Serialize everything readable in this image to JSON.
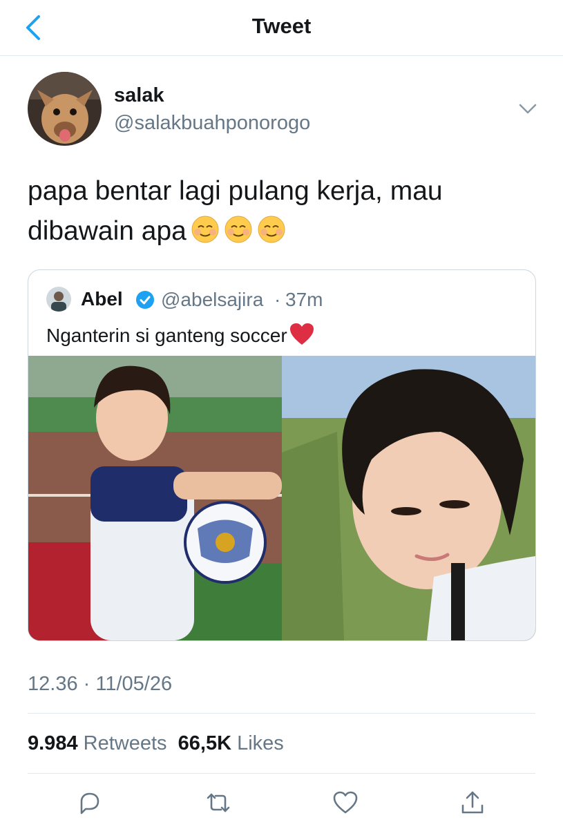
{
  "header": {
    "title": "Tweet"
  },
  "tweet": {
    "display_name": "salak",
    "handle": "@salakbuahponorogo",
    "text": "papa bentar lagi pulang kerja, mau dibawain apa",
    "emojis": [
      "smiling-face-icon",
      "smiling-face-icon",
      "smiling-face-icon"
    ],
    "timestamp": "12.36 · 11/05/26",
    "stats": {
      "retweets_count": "9.984",
      "retweets_label": "Retweets",
      "likes_count": "66,5K",
      "likes_label": "Likes"
    }
  },
  "quoted_tweet": {
    "display_name": "Abel",
    "handle": "@abelsajira",
    "separator": "·",
    "time": "37m",
    "text": "Nganterin si ganteng soccer",
    "text_emoji": "red-heart-icon",
    "media": [
      "boy-with-soccer-ball-photo",
      "selfie-on-field-photo"
    ]
  },
  "actions": [
    "reply-icon",
    "retweet-icon",
    "like-icon",
    "share-icon"
  ],
  "colors": {
    "accent": "#1da1f2",
    "text": "#14171a",
    "secondary": "#657786",
    "border": "#e1e8ed"
  }
}
